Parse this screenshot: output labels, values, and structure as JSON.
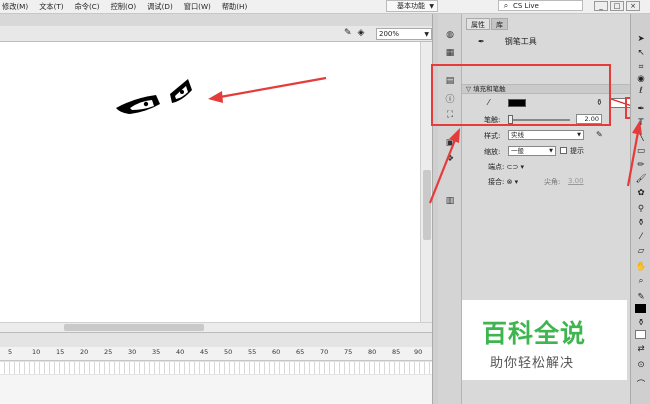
{
  "menu": {
    "items": [
      "修改(M)",
      "文本(T)",
      "命令(C)",
      "控制(O)",
      "调试(D)",
      "窗口(W)",
      "帮助(H)"
    ],
    "workspace": "基本功能",
    "search_label": "CS Live"
  },
  "window_controls": [
    "_",
    "□",
    "×"
  ],
  "stage": {
    "zoom": "200%"
  },
  "timeline": {
    "ticks": [
      "5",
      "10",
      "15",
      "20",
      "25",
      "30",
      "35",
      "40",
      "45",
      "50",
      "55",
      "60",
      "65",
      "70",
      "75",
      "80",
      "85",
      "90"
    ]
  },
  "properties": {
    "tabs": [
      "属性",
      "库"
    ],
    "tool_name": "钢笔工具",
    "section_title": "填充和笔触",
    "stroke_color": "#000000",
    "stroke_label": "笔触:",
    "stroke_value": "2.00",
    "style_label": "样式:",
    "style_value": "实线",
    "scale_label": "缩放:",
    "scale_value": "一般",
    "hint_label": "提示",
    "cap_label": "端点:",
    "join_label": "接合:",
    "miter_label": "尖角:",
    "miter_value": "3.00"
  },
  "annotation_color": "#e63b3b",
  "watermark": {
    "title": "百科全说",
    "subtitle": "助你轻松解决",
    "color": "#3fb54f"
  }
}
